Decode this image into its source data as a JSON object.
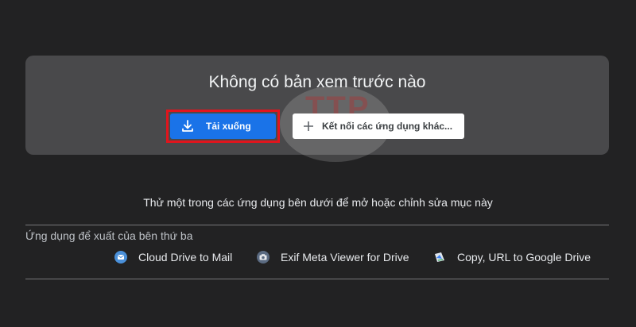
{
  "preview": {
    "title": "Không có bản xem trước nào",
    "download_label": "Tải xuống",
    "connect_label": "Kết nối các ứng dụng khác...",
    "watermark_text": "TTP"
  },
  "instruction": "Thử một trong các ứng dụng bên dưới để mở hoặc chỉnh sửa mục này",
  "suggested": {
    "label": "Ứng dụng để xuất của bên thứ ba",
    "apps": [
      {
        "name": "Cloud Drive to Mail",
        "icon": "mail-app-icon"
      },
      {
        "name": "Exif Meta Viewer for Drive",
        "icon": "camera-app-icon"
      },
      {
        "name": "Copy, URL to Google Drive",
        "icon": "drive-copy-app-icon"
      }
    ]
  },
  "colors": {
    "background": "#222223",
    "card": "#49494b",
    "primary_button": "#1a73e8",
    "highlight": "#e2141c"
  }
}
